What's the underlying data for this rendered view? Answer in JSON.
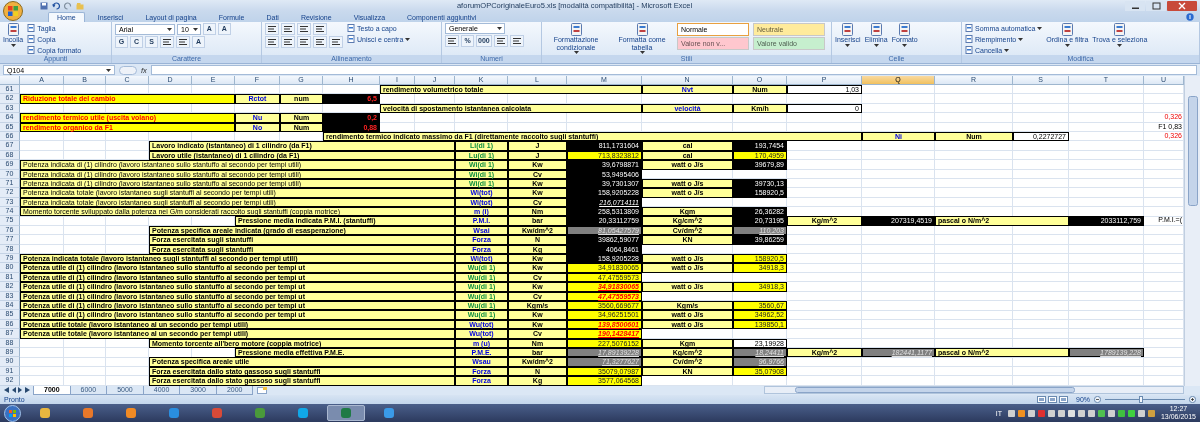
{
  "window": {
    "title": "aforumOPCoriginaleEuro5.xls  [modalità compatibilità] - Microsoft Excel"
  },
  "ribbon": {
    "tabs": [
      {
        "label": "Home",
        "selected": true
      },
      {
        "label": "Inserisci",
        "selected": false
      },
      {
        "label": "Layout di pagina",
        "selected": false
      },
      {
        "label": "Formule",
        "selected": false
      },
      {
        "label": "Dati",
        "selected": false
      },
      {
        "label": "Revisione",
        "selected": false
      },
      {
        "label": "Visualizza",
        "selected": false
      },
      {
        "label": "Componenti aggiuntivi",
        "selected": false
      }
    ],
    "groups": [
      {
        "name": "Appunti",
        "stacks": [
          {
            "lines": [
              {
                "controls": [
                  {
                    "kind": "large",
                    "label": "Incolla",
                    "caret": true
                  }
                ]
              }
            ]
          },
          {
            "lines": [
              {
                "controls": [
                  {
                    "kind": "small",
                    "label": "Taglia"
                  }
                ]
              },
              {
                "controls": [
                  {
                    "kind": "small",
                    "label": "Copia"
                  }
                ]
              },
              {
                "controls": [
                  {
                    "kind": "small",
                    "label": "Copia formato"
                  }
                ]
              }
            ]
          }
        ]
      },
      {
        "name": "Carattere",
        "stacks": [
          {
            "lines": [
              {
                "controls": [
                  {
                    "kind": "field",
                    "label": "Arial"
                  },
                  {
                    "kind": "field",
                    "label": "10"
                  },
                  {
                    "kind": "glyph",
                    "label": "A"
                  },
                  {
                    "kind": "glyph",
                    "label": "A"
                  }
                ]
              },
              {
                "controls": [
                  {
                    "kind": "glyph",
                    "label": "G"
                  },
                  {
                    "kind": "glyph",
                    "label": "C"
                  },
                  {
                    "kind": "glyph",
                    "label": "S"
                  },
                  {
                    "kind": "iconbtn"
                  },
                  {
                    "kind": "iconbtn"
                  },
                  {
                    "kind": "glyph",
                    "label": "A"
                  }
                ]
              }
            ]
          }
        ]
      },
      {
        "name": "Allineamento",
        "stacks": [
          {
            "lines": [
              {
                "controls": [
                  {
                    "kind": "iconbtn"
                  },
                  {
                    "kind": "iconbtn"
                  },
                  {
                    "kind": "iconbtn"
                  },
                  {
                    "kind": "iconbtn"
                  }
                ]
              },
              {
                "controls": [
                  {
                    "kind": "iconbtn"
                  },
                  {
                    "kind": "iconbtn"
                  },
                  {
                    "kind": "iconbtn"
                  },
                  {
                    "kind": "iconbtn"
                  },
                  {
                    "kind": "iconbtn"
                  }
                ]
              }
            ]
          },
          {
            "lines": [
              {
                "controls": [
                  {
                    "kind": "small",
                    "label": "Testo a capo"
                  }
                ]
              },
              {
                "controls": [
                  {
                    "kind": "small",
                    "label": "Unisci e centra",
                    "caret": true
                  }
                ]
              }
            ]
          }
        ]
      },
      {
        "name": "Numeri",
        "stacks": [
          {
            "lines": [
              {
                "controls": [
                  {
                    "kind": "field",
                    "label": "Generale"
                  }
                ]
              },
              {
                "controls": [
                  {
                    "kind": "iconbtn"
                  },
                  {
                    "kind": "glyph",
                    "label": "%"
                  },
                  {
                    "kind": "glyph",
                    "label": "000"
                  },
                  {
                    "kind": "iconbtn"
                  },
                  {
                    "kind": "iconbtn"
                  }
                ]
              }
            ]
          }
        ]
      },
      {
        "name": "Stili",
        "stacks": [
          {
            "lines": [
              {
                "controls": [
                  {
                    "kind": "large",
                    "label": "Formattazione condizionale",
                    "caret": true
                  }
                ]
              }
            ]
          },
          {
            "lines": [
              {
                "controls": [
                  {
                    "kind": "large",
                    "label": "Formatta come tabella",
                    "caret": true
                  }
                ]
              }
            ]
          },
          {
            "lines": [
              {
                "controls": [
                  {
                    "kind": "style",
                    "label": "Normale",
                    "color": "#ffffff",
                    "selected": true
                  }
                ]
              },
              {
                "controls": [
                  {
                    "kind": "style",
                    "label": "Valore non v...",
                    "color": "#ffc7ce",
                    "selected": false
                  }
                ]
              }
            ]
          },
          {
            "lines": [
              {
                "controls": [
                  {
                    "kind": "style",
                    "label": "Neutrale",
                    "color": "#ffeb9c",
                    "selected": false
                  }
                ]
              },
              {
                "controls": [
                  {
                    "kind": "style",
                    "label": "Valore valido",
                    "color": "#c6efce",
                    "selected": false
                  }
                ]
              }
            ]
          }
        ]
      },
      {
        "name": "Celle",
        "stacks": [
          {
            "lines": [
              {
                "controls": [
                  {
                    "kind": "large",
                    "label": "Inserisci",
                    "caret": true
                  }
                ]
              }
            ]
          },
          {
            "lines": [
              {
                "controls": [
                  {
                    "kind": "large",
                    "label": "Elimina",
                    "caret": true
                  }
                ]
              }
            ]
          },
          {
            "lines": [
              {
                "controls": [
                  {
                    "kind": "large",
                    "label": "Formato",
                    "caret": true
                  }
                ]
              }
            ]
          }
        ]
      },
      {
        "name": "Modifica",
        "stacks": [
          {
            "lines": [
              {
                "controls": [
                  {
                    "kind": "small",
                    "label": "Somma automatica",
                    "caret": true
                  }
                ]
              },
              {
                "controls": [
                  {
                    "kind": "small",
                    "label": "Riempimento",
                    "caret": true
                  }
                ]
              },
              {
                "controls": [
                  {
                    "kind": "small",
                    "label": "Cancella",
                    "caret": true
                  }
                ]
              }
            ]
          },
          {
            "lines": [
              {
                "controls": [
                  {
                    "kind": "large",
                    "label": "Ordina e filtra",
                    "caret": true
                  }
                ]
              }
            ]
          },
          {
            "lines": [
              {
                "controls": [
                  {
                    "kind": "large",
                    "label": "Trova e seleziona",
                    "caret": true
                  }
                ]
              }
            ]
          }
        ]
      }
    ]
  },
  "formula_bar": {
    "name_box": "Q104",
    "function_label": "fx"
  },
  "sheet": {
    "columns": [
      {
        "label": "A",
        "selected": false
      },
      {
        "label": "B",
        "selected": false
      },
      {
        "label": "C",
        "selected": false
      },
      {
        "label": "D",
        "selected": false
      },
      {
        "label": "E",
        "selected": false
      },
      {
        "label": "F",
        "selected": false
      },
      {
        "label": "G",
        "selected": false
      },
      {
        "label": "H",
        "selected": false
      },
      {
        "label": "I",
        "selected": false
      },
      {
        "label": "J",
        "selected": false
      },
      {
        "label": "K",
        "selected": false
      },
      {
        "label": "L",
        "selected": false
      },
      {
        "label": "M",
        "selected": false
      },
      {
        "label": "N",
        "selected": false
      },
      {
        "label": "O",
        "selected": false
      },
      {
        "label": "P",
        "selected": false
      },
      {
        "label": "Q",
        "selected": true
      },
      {
        "label": "R",
        "selected": false
      },
      {
        "label": "S",
        "selected": false
      },
      {
        "label": "T",
        "selected": false
      },
      {
        "label": "U",
        "selected": false
      }
    ],
    "rows": [
      {
        "number": "61",
        "cells": {
          "I": {
            "text": "rendimento volumetrico totale",
            "kind": "label"
          },
          "N": {
            "text": "Nvt",
            "kind": "total"
          },
          "O": {
            "text": "Num",
            "kind": "unit"
          },
          "P": {
            "text": "1,03",
            "kind": "input"
          }
        }
      },
      {
        "number": "62",
        "cells": {
          "A": {
            "text": "Riduzione totale del cambio",
            "kind": "title"
          },
          "F": {
            "text": "Rctot",
            "kind": "total"
          },
          "G": {
            "text": "num",
            "kind": "unit"
          },
          "H": {
            "text": "6,5",
            "kind": "darkred"
          }
        }
      },
      {
        "number": "63",
        "cells": {
          "I": {
            "text": "velocità di spostamento istantanea calcolata",
            "kind": "label"
          },
          "N": {
            "text": "velocità",
            "kind": "total"
          },
          "O": {
            "text": "Km/h",
            "kind": "unit"
          },
          "P": {
            "text": "0",
            "kind": "input"
          }
        }
      },
      {
        "number": "64",
        "cells": {
          "A": {
            "text": "rendimento termico utile (uscita volano)",
            "kind": "title"
          },
          "F": {
            "text": "Nu",
            "kind": "total"
          },
          "G": {
            "text": "Num",
            "kind": "unit"
          },
          "H": {
            "text": "0,2",
            "kind": "darkred"
          },
          "U": {
            "text": "0,326",
            "kind": "warn"
          }
        }
      },
      {
        "number": "65",
        "cells": {
          "A": {
            "text": "rendimento organico da F1",
            "kind": "title"
          },
          "F": {
            "text": "No",
            "kind": "total"
          },
          "G": {
            "text": "Num",
            "kind": "unit"
          },
          "H": {
            "text": "0,88",
            "kind": "darkred"
          },
          "U": {
            "text": "F1 0,83",
            "kind": "note"
          }
        }
      },
      {
        "number": "66",
        "cells": {
          "H": {
            "text": "rendimento termico indicato massimo da F1 (direttamente raccolto sugli stantuffi)",
            "kind": "label"
          },
          "Q": {
            "text": "Ni",
            "kind": "total"
          },
          "R": {
            "text": "Num",
            "kind": "unit"
          },
          "S": {
            "text": "0,2272727",
            "kind": "input"
          },
          "U": {
            "text": "0,326",
            "kind": "warn"
          }
        }
      },
      {
        "number": "67",
        "cells": {
          "D": {
            "text": "Lavoro indicato (istantaneo) di 1 cilindro (da F1)",
            "kind": "label"
          },
          "K": {
            "text": "Li(di 1)",
            "kind": "single"
          },
          "L": {
            "text": "J",
            "kind": "unit"
          },
          "M": {
            "text": "811,1731604",
            "kind": "dark"
          },
          "N": {
            "text": "cal",
            "kind": "unit"
          },
          "O": {
            "text": "193,7454",
            "kind": "dark"
          }
        }
      },
      {
        "number": "68",
        "cells": {
          "D": {
            "text": "Lavoro utile (istantaneo) di 1 cilindro (da F1)",
            "kind": "label"
          },
          "K": {
            "text": "Lu(di 1)",
            "kind": "single"
          },
          "L": {
            "text": "J",
            "kind": "unit"
          },
          "M": {
            "text": "713,8323812",
            "kind": "bright"
          },
          "N": {
            "text": "cal",
            "kind": "unit"
          },
          "O": {
            "text": "170,4959",
            "kind": "bright"
          }
        }
      },
      {
        "number": "69",
        "cells": {
          "A": {
            "text": "Potenza indicata di (1) cilindro (lavoro istantaneo sullo stantuffo al secondo per tempi utili)",
            "kind": "caption"
          },
          "K": {
            "text": "Wi(di 1)",
            "kind": "single"
          },
          "L": {
            "text": "Kw",
            "kind": "unit"
          },
          "M": {
            "text": "39,6798871",
            "kind": "dark"
          },
          "N": {
            "text": "watt o  J/s",
            "kind": "unit"
          },
          "O": {
            "text": "39679,89",
            "kind": "dark"
          }
        }
      },
      {
        "number": "70",
        "cells": {
          "A": {
            "text": "Potenza indicata di (1) cilindro (lavoro istantaneo sullo stantuffo al secondo per tempi utili)",
            "kind": "caption"
          },
          "K": {
            "text": "Wi(di 1)",
            "kind": "single"
          },
          "L": {
            "text": "Cv",
            "kind": "unit"
          },
          "M": {
            "text": "53,9495406",
            "kind": "dark"
          }
        }
      },
      {
        "number": "71",
        "cells": {
          "A": {
            "text": "Potenza indicata di (1) cilindro (lavoro istantaneo sullo stantuffo al secondo per tempi utili)",
            "kind": "caption"
          },
          "K": {
            "text": "Wi(di 1)",
            "kind": "single"
          },
          "L": {
            "text": "Kw",
            "kind": "unit"
          },
          "M": {
            "text": "39,7301307",
            "kind": "dark"
          },
          "N": {
            "text": "watt o  J/s",
            "kind": "unit"
          },
          "O": {
            "text": "39730,13",
            "kind": "dark"
          }
        }
      },
      {
        "number": "72",
        "cells": {
          "A": {
            "text": "Potenza indicata totale (lavoro istantaneo sugli stantuffi al secondo per tempi utili)",
            "kind": "caption"
          },
          "K": {
            "text": "Wi(tot)",
            "kind": "total"
          },
          "L": {
            "text": "Kw",
            "kind": "unit"
          },
          "M": {
            "text": "158,9205228",
            "kind": "dark"
          },
          "N": {
            "text": "watt o  J/s",
            "kind": "unit"
          },
          "O": {
            "text": "158920,5",
            "kind": "dark"
          }
        }
      },
      {
        "number": "73",
        "cells": {
          "A": {
            "text": "Potenza indicata totale (lavoro istantaneo sugli stantuffi al secondo per tempi utili)",
            "kind": "caption"
          },
          "K": {
            "text": "Wi(tot)",
            "kind": "total"
          },
          "L": {
            "text": "Cv",
            "kind": "unit"
          },
          "M": {
            "text": "216,0714111",
            "kind": "darkitalic"
          }
        }
      },
      {
        "number": "74",
        "cells": {
          "A": {
            "text": "Momento torcente sviluppato dalla potenza nei G/m considerati raccolto sugli stantuffi (coppia motrice)",
            "kind": "caption"
          },
          "K": {
            "text": "m (i)",
            "kind": "total"
          },
          "L": {
            "text": "Nm",
            "kind": "unit"
          },
          "M": {
            "text": "258,5313809",
            "kind": "dark"
          },
          "N": {
            "text": "Kgm",
            "kind": "unit"
          },
          "O": {
            "text": "26,36282",
            "kind": "dark"
          }
        }
      },
      {
        "number": "75",
        "cells": {
          "F": {
            "text": "Pressione media indicata P.M.I. (stantuffi)",
            "kind": "label"
          },
          "K": {
            "text": "P.M.I.",
            "kind": "total"
          },
          "L": {
            "text": "bar",
            "kind": "unit"
          },
          "M": {
            "text": "20,33112759",
            "kind": "dark"
          },
          "N": {
            "text": "Kg/cm^2",
            "kind": "unit"
          },
          "O": {
            "text": "20,73195",
            "kind": "dark"
          },
          "P": {
            "text": "Kg/m^2",
            "kind": "unit"
          },
          "Q": {
            "text": "207319,4519",
            "kind": "dark"
          },
          "R": {
            "text": "pascal o N/m^2",
            "kind": "label"
          },
          "T": {
            "text": "2033112,759",
            "kind": "dark"
          },
          "U": {
            "text": "P.M.I.=(",
            "kind": "note"
          }
        }
      },
      {
        "number": "76",
        "cells": {
          "D": {
            "text": "Potenza specifica areale indicata (grado di esasperazione)",
            "kind": "label"
          },
          "K": {
            "text": "Wsai",
            "kind": "total"
          },
          "L": {
            "text": "Kw/dm^2",
            "kind": "unit"
          },
          "M": {
            "text": "81,05427579",
            "kind": "grey"
          },
          "N": {
            "text": "Cv/dm^2",
            "kind": "unit"
          },
          "O": {
            "text": "110,203",
            "kind": "grey"
          }
        }
      },
      {
        "number": "77",
        "cells": {
          "D": {
            "text": "Forza esercitata sugli stantuffi",
            "kind": "label"
          },
          "K": {
            "text": "Forza",
            "kind": "total"
          },
          "L": {
            "text": "N",
            "kind": "unit"
          },
          "M": {
            "text": "39862,59077",
            "kind": "dark"
          },
          "N": {
            "text": "KN",
            "kind": "unit"
          },
          "O": {
            "text": "39,86259",
            "kind": "dark"
          }
        }
      },
      {
        "number": "78",
        "cells": {
          "D": {
            "text": "Forza esercitata sugli stantuffi",
            "kind": "label"
          },
          "K": {
            "text": "Forza",
            "kind": "total"
          },
          "L": {
            "text": "Kg",
            "kind": "unit"
          },
          "M": {
            "text": "4064,8461",
            "kind": "dark"
          }
        }
      },
      {
        "number": "79",
        "cells": {
          "A": {
            "text": "Potenza indicata totale (lavoro istantaneo sugli stantuffi al secondo per tempi utili)",
            "kind": "label"
          },
          "K": {
            "text": "Wi(tot)",
            "kind": "total"
          },
          "L": {
            "text": "Kw",
            "kind": "unit"
          },
          "M": {
            "text": "158,9205228",
            "kind": "dark"
          },
          "N": {
            "text": "watt o  J/s",
            "kind": "unit"
          },
          "O": {
            "text": "158920,5",
            "kind": "bright"
          }
        }
      },
      {
        "number": "80",
        "cells": {
          "A": {
            "text": "Potenza utile di (1) cilindro (lavoro istantaneo sullo stantuffo al secondo per tempi ut",
            "kind": "label"
          },
          "K": {
            "text": "Wu(di 1)",
            "kind": "single"
          },
          "L": {
            "text": "Kw",
            "kind": "unit"
          },
          "M": {
            "text": "34,91830065",
            "kind": "bright"
          },
          "N": {
            "text": "watt o  J/s",
            "kind": "unit"
          },
          "O": {
            "text": "34918,3",
            "kind": "bright"
          }
        }
      },
      {
        "number": "81",
        "cells": {
          "A": {
            "text": "Potenza utile di (1) cilindro (lavoro istantaneo sullo stantuffo al secondo per tempi ut",
            "kind": "label"
          },
          "K": {
            "text": "Wu(di 1)",
            "kind": "single"
          },
          "L": {
            "text": "Cv",
            "kind": "unit"
          },
          "M": {
            "text": "47,47559573",
            "kind": "bright"
          }
        }
      },
      {
        "number": "82",
        "cells": {
          "A": {
            "text": "Potenza utile di (1) cilindro (lavoro istantaneo sullo stantuffo al secondo per tempi ut",
            "kind": "label"
          },
          "K": {
            "text": "Wu(di 1)",
            "kind": "single"
          },
          "L": {
            "text": "Kw",
            "kind": "unit"
          },
          "M": {
            "text": "34,91830065",
            "kind": "alert"
          },
          "N": {
            "text": "watt o  J/s",
            "kind": "unit"
          },
          "O": {
            "text": "34918,3",
            "kind": "bright"
          }
        }
      },
      {
        "number": "83",
        "cells": {
          "A": {
            "text": "Potenza utile di (1) cilindro (lavoro istantaneo sullo stantuffo al secondo per tempi ut",
            "kind": "label"
          },
          "K": {
            "text": "Wu(di 1)",
            "kind": "single"
          },
          "L": {
            "text": "Cv",
            "kind": "unit"
          },
          "M": {
            "text": "47,47559573",
            "kind": "alert"
          }
        }
      },
      {
        "number": "84",
        "cells": {
          "A": {
            "text": "Potenza utile di (1) cilindro (lavoro istantaneo sullo stantuffo al secondo per tempi ut",
            "kind": "label"
          },
          "K": {
            "text": "Wu(di 1)",
            "kind": "single"
          },
          "L": {
            "text": "Kgm/s",
            "kind": "unit"
          },
          "M": {
            "text": "3560,669677",
            "kind": "bright"
          },
          "N": {
            "text": "Kgm/s",
            "kind": "unit"
          },
          "O": {
            "text": "3560,67",
            "kind": "bright"
          }
        }
      },
      {
        "number": "85",
        "cells": {
          "A": {
            "text": "Potenza utile di (1) cilindro (lavoro istantaneo sullo stantuffo al secondo per tempi ut",
            "kind": "label"
          },
          "K": {
            "text": "Wu(di 1)",
            "kind": "single"
          },
          "L": {
            "text": "Kw",
            "kind": "unit"
          },
          "M": {
            "text": "34,96251501",
            "kind": "bright"
          },
          "N": {
            "text": "watt o  J/s",
            "kind": "unit"
          },
          "O": {
            "text": "34962,52",
            "kind": "bright"
          }
        }
      },
      {
        "number": "86",
        "cells": {
          "A": {
            "text": "Potenza utile totale (lavoro istantaneo al un secondo per tempi utili)",
            "kind": "label"
          },
          "K": {
            "text": "Wu(tot)",
            "kind": "total"
          },
          "L": {
            "text": "Kw",
            "kind": "unit"
          },
          "M": {
            "text": "139,8500601",
            "kind": "alert"
          },
          "N": {
            "text": "watt o  J/s",
            "kind": "unit"
          },
          "O": {
            "text": "139850,1",
            "kind": "bright"
          }
        }
      },
      {
        "number": "87",
        "cells": {
          "A": {
            "text": "Potenza utile totale (lavoro istantaneo al un secondo per tempi utili)",
            "kind": "label"
          },
          "K": {
            "text": "Wu(tot)",
            "kind": "total"
          },
          "L": {
            "text": "Cv",
            "kind": "unit"
          },
          "M": {
            "text": "190,1428417",
            "kind": "alert"
          }
        }
      },
      {
        "number": "88",
        "cells": {
          "D": {
            "text": "Momento torcente all'bero motore (coppia motrice)",
            "kind": "label"
          },
          "K": {
            "text": "m (u)",
            "kind": "total"
          },
          "L": {
            "text": "Nm",
            "kind": "unit"
          },
          "M": {
            "text": "227,5076152",
            "kind": "bright"
          },
          "N": {
            "text": "Kgm",
            "kind": "unit"
          },
          "O": {
            "text": "23,19928",
            "kind": "input"
          }
        }
      },
      {
        "number": "89",
        "cells": {
          "F": {
            "text": "Pressione media effettiva P.M.E.",
            "kind": "label"
          },
          "K": {
            "text": "P.M.E.",
            "kind": "total"
          },
          "L": {
            "text": "bar",
            "kind": "unit"
          },
          "M": {
            "text": "17,89139228",
            "kind": "grey"
          },
          "N": {
            "text": "Kg/cm^2",
            "kind": "unit"
          },
          "O": {
            "text": "18,24411",
            "kind": "grey"
          },
          "P": {
            "text": "Kg/m^2",
            "kind": "unit"
          },
          "Q": {
            "text": "182441,1177",
            "kind": "grey"
          },
          "R": {
            "text": "pascal o N/m^2",
            "kind": "label"
          },
          "T": {
            "text": "1789139,228",
            "kind": "grey"
          }
        }
      },
      {
        "number": "90",
        "cells": {
          "D": {
            "text": "Potenza specifica areale utile",
            "kind": "label"
          },
          "K": {
            "text": "Wsau",
            "kind": "total"
          },
          "L": {
            "text": "Kw/dm^2",
            "kind": "unit"
          },
          "M": {
            "text": "71,3277627",
            "kind": "grey"
          },
          "N": {
            "text": "Cv/dm^2",
            "kind": "unit"
          },
          "O": {
            "text": "96,9766",
            "kind": "grey"
          }
        }
      },
      {
        "number": "91",
        "cells": {
          "D": {
            "text": "Forza esercitata  dallo stato gassoso sugli stantuffi",
            "kind": "label"
          },
          "K": {
            "text": "Forza",
            "kind": "total"
          },
          "L": {
            "text": "N",
            "kind": "unit"
          },
          "M": {
            "text": "35079,07987",
            "kind": "bright"
          },
          "N": {
            "text": "KN",
            "kind": "unit"
          },
          "O": {
            "text": "35,07908",
            "kind": "bright"
          }
        }
      },
      {
        "number": "92",
        "cells": {
          "D": {
            "text": "Forza esercitata  dallo stato gassoso sugli stantuffi",
            "kind": "label"
          },
          "K": {
            "text": "Forza",
            "kind": "total"
          },
          "L": {
            "text": "Kg",
            "kind": "unit"
          },
          "M": {
            "text": "3577,064568",
            "kind": "bright"
          }
        }
      }
    ]
  },
  "sheet_tabs": [
    {
      "label": "7000",
      "selected": true
    },
    {
      "label": "6000",
      "selected": false
    },
    {
      "label": "5000",
      "selected": false
    },
    {
      "label": "4000",
      "selected": false
    },
    {
      "label": "3000",
      "selected": false
    },
    {
      "label": "2000",
      "selected": false
    }
  ],
  "status_bar": {
    "status": "Pronto",
    "zoom": "90%",
    "zoom_slider": {
      "level": 0.45
    }
  },
  "taskbar": {
    "apps": [
      {
        "color": "#e8b640",
        "selected": false
      },
      {
        "color": "#e8782a",
        "selected": false
      },
      {
        "color": "#f08a24",
        "selected": false
      },
      {
        "color": "#2a8ee0",
        "selected": false
      },
      {
        "color": "#d84a38",
        "selected": false
      },
      {
        "color": "#4a9a3a",
        "selected": false
      },
      {
        "color": "#10a8e8",
        "selected": false
      },
      {
        "color": "#1f7a46",
        "selected": true
      },
      {
        "color": "#3a9ae8",
        "selected": false
      }
    ],
    "language": "IT",
    "time": "12:27",
    "date": "13/06/2015"
  }
}
